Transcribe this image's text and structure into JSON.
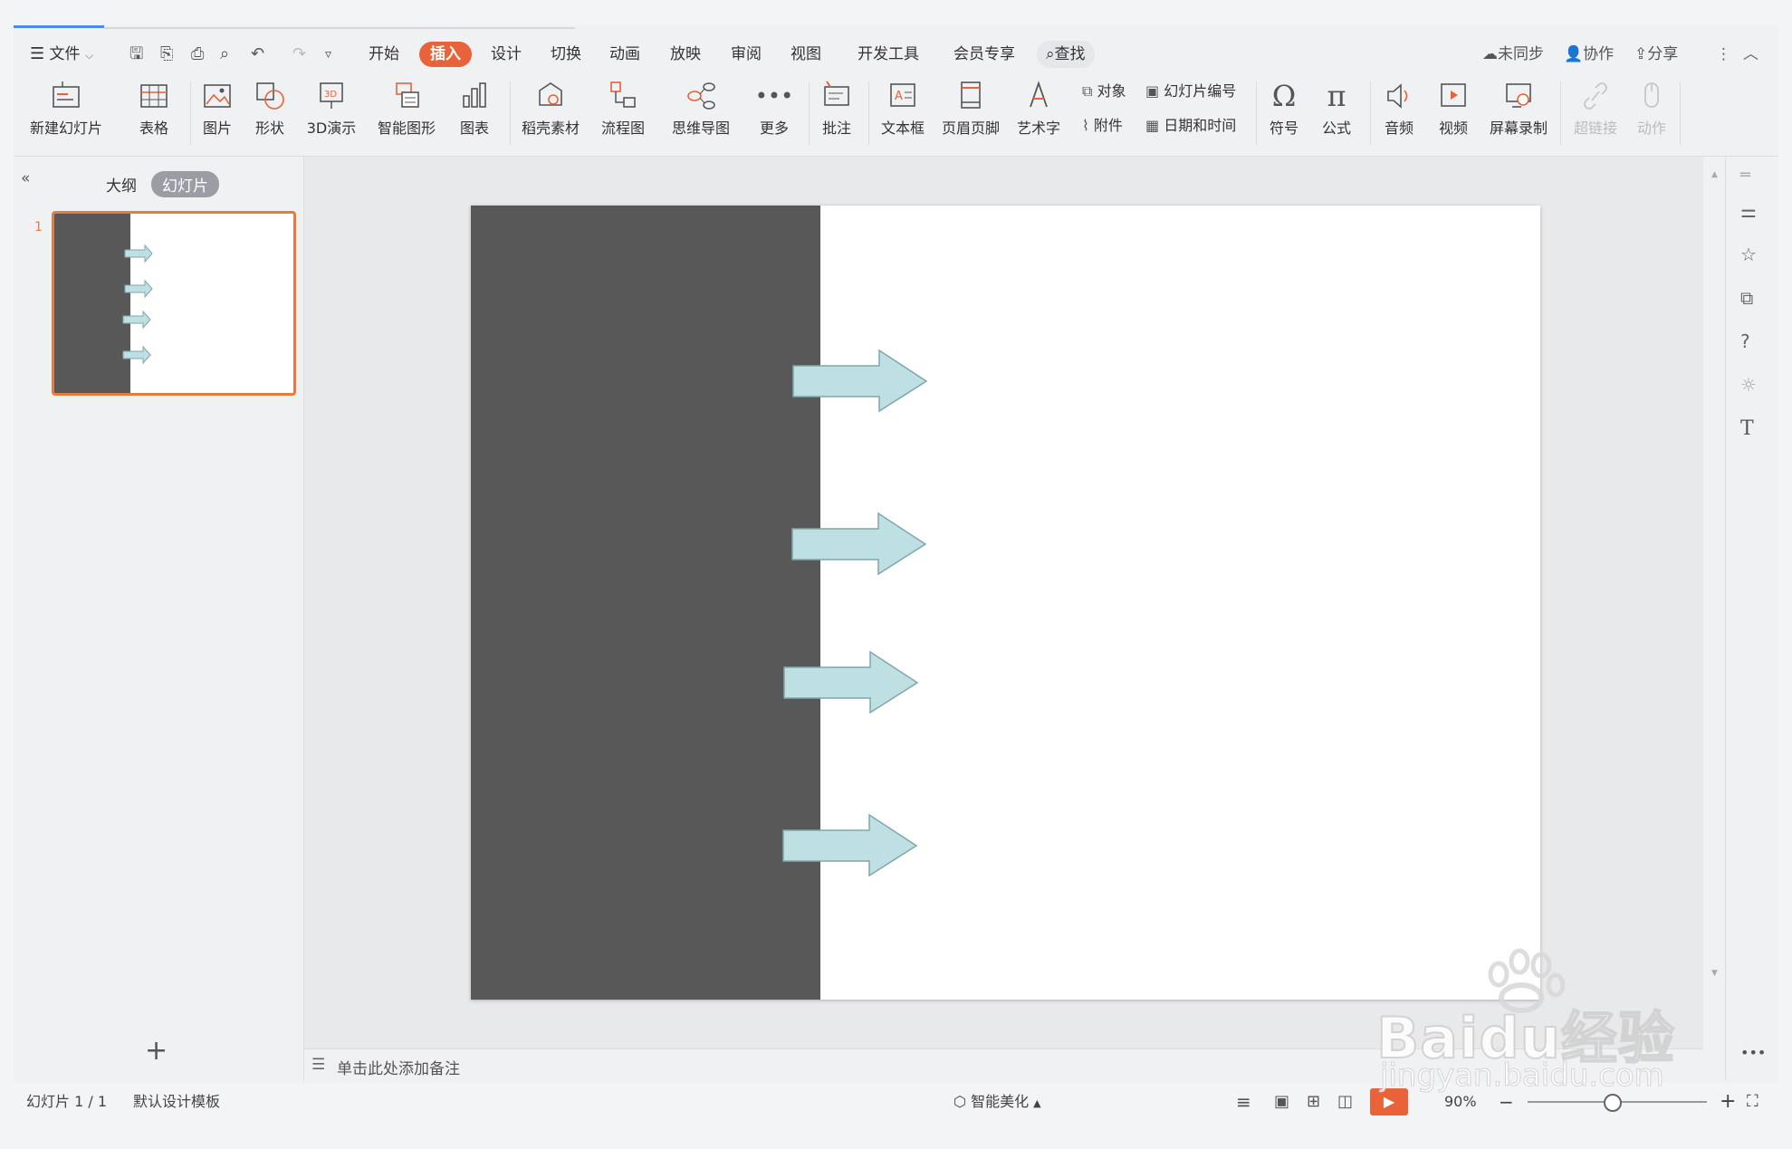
{
  "menu": {
    "file_label": "文件",
    "tabs": [
      "开始",
      "插入",
      "设计",
      "切换",
      "动画",
      "放映",
      "审阅",
      "视图",
      "开发工具",
      "会员专享"
    ],
    "active_tab": "插入",
    "search_label": "查找",
    "sync_label": "未同步",
    "collab_label": "协作",
    "share_label": "分享"
  },
  "ribbon": {
    "new_slide": "新建幻灯片",
    "table": "表格",
    "picture": "图片",
    "shape": "形状",
    "demo3d": "3D演示",
    "smart_graphic": "智能图形",
    "chart": "图表",
    "docer_material": "稻壳素材",
    "flowchart": "流程图",
    "mindmap": "思维导图",
    "more": "更多",
    "comment": "批注",
    "textbox": "文本框",
    "header_footer": "页眉页脚",
    "wordart": "艺术字",
    "object": "对象",
    "slide_number": "幻灯片编号",
    "attachment": "附件",
    "date_time": "日期和时间",
    "symbol": "符号",
    "formula": "公式",
    "audio": "音频",
    "video": "视频",
    "screen_record": "屏幕录制",
    "hyperlink": "超链接",
    "action": "动作"
  },
  "left_panel": {
    "outline_tab": "大纲",
    "slides_tab": "幻灯片",
    "slide_index": "1",
    "add_label": "+"
  },
  "notes": {
    "placeholder": "单击此处添加备注"
  },
  "status": {
    "slide_counter": "幻灯片 1 / 1",
    "template": "默认设计模板",
    "beautify": "智能美化",
    "zoom": "90%"
  },
  "watermark": {
    "brand": "Baidu经验",
    "url": "jingyan.baidu.com"
  },
  "colors": {
    "accent": "#e8623a",
    "dark_panel": "#585858",
    "arrow_fill": "#bfe0e2",
    "arrow_stroke": "#7fa7ab",
    "thumb_border": "#e8793f"
  }
}
